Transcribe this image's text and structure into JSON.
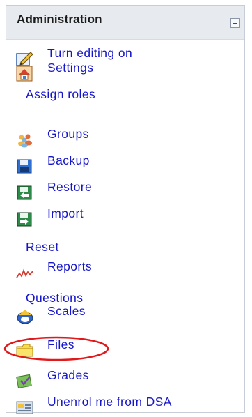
{
  "block": {
    "title": "Administration",
    "items": [
      {
        "label": "Turn editing on",
        "icon": "edit-pencil-icon"
      },
      {
        "label": "Settings",
        "icon": "settings-house-icon"
      },
      {
        "label": "Assign roles",
        "icon": null
      },
      {
        "label": "Groups",
        "icon": "groups-people-icon"
      },
      {
        "label": "Backup",
        "icon": "backup-disk-icon"
      },
      {
        "label": "Restore",
        "icon": "restore-icon"
      },
      {
        "label": "Import",
        "icon": "import-icon"
      },
      {
        "label": "Reset",
        "icon": null
      },
      {
        "label": "Reports",
        "icon": "reports-graph-icon"
      },
      {
        "label": "Questions",
        "icon": null
      },
      {
        "label": "Scales",
        "icon": "scales-icon"
      },
      {
        "label": "Files",
        "icon": "folder-icon"
      },
      {
        "label": "Grades",
        "icon": "grades-icon"
      },
      {
        "label": "Unenrol me from DSA",
        "icon": "unenrol-icon"
      }
    ]
  },
  "colors": {
    "link": "#1515c9",
    "header_bg": "#e7ebef",
    "highlight_circle": "#e0191b"
  }
}
